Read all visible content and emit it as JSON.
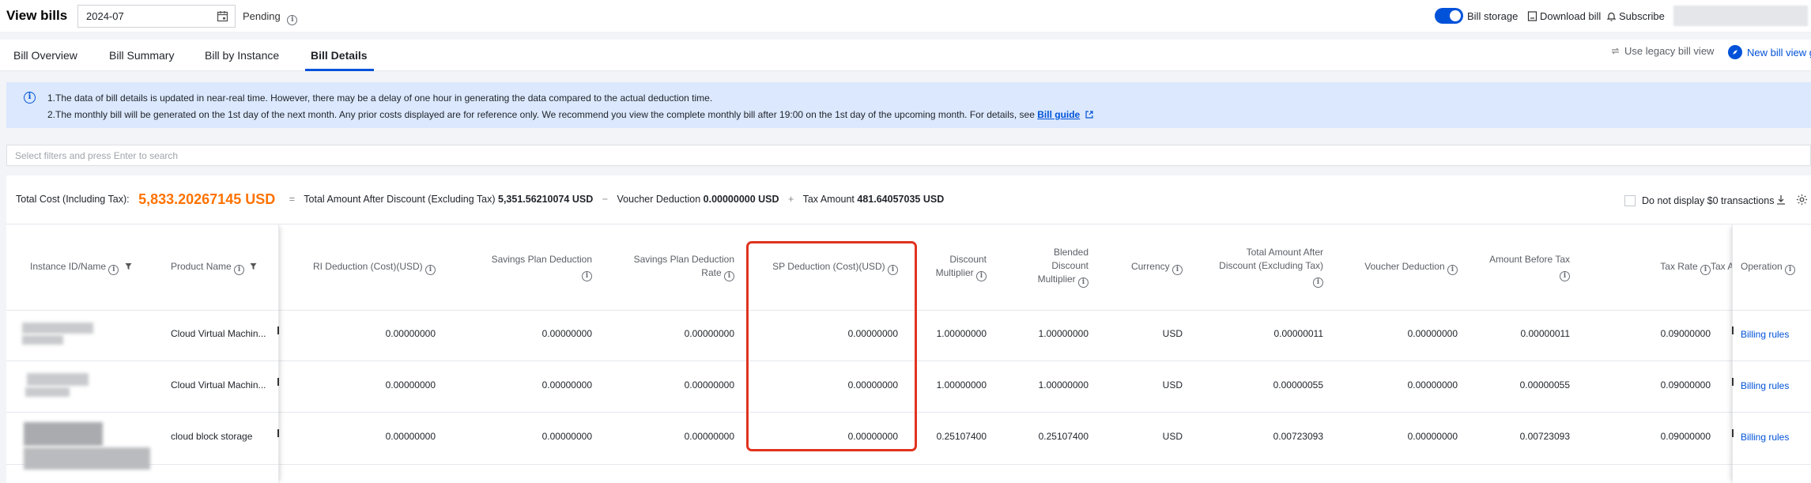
{
  "header": {
    "title": "View bills",
    "date_value": "2024-07",
    "status": "Pending",
    "bill_storage_label": "Bill storage",
    "download_label": "Download bill",
    "subscribe_label": "Subscribe"
  },
  "tabs": [
    {
      "label": "Bill Overview",
      "active": false
    },
    {
      "label": "Bill Summary",
      "active": false
    },
    {
      "label": "Bill by Instance",
      "active": false
    },
    {
      "label": "Bill Details",
      "active": true
    }
  ],
  "view_links": {
    "legacy": "Use legacy bill view",
    "new": "New bill view g"
  },
  "notice": {
    "line1": "1.The data of bill details is updated in near-real time. However, there may be a delay of one hour in generating the data compared to the actual deduction time.",
    "line2": "2.The monthly bill will be generated on the 1st day of the next month. Any prior costs displayed are for reference only. We recommend you view the complete monthly bill after 19:00 on the 1st day of the upcoming month. For details, see",
    "guide_link": "Bill guide"
  },
  "search": {
    "placeholder": "Select filters and press Enter to search"
  },
  "totals": {
    "label": "Total Cost (Including Tax):",
    "total_value": "5,833.20267145 USD",
    "eq": "=",
    "after_discount_label": "Total Amount After Discount (Excluding Tax)",
    "after_discount_value": "5,351.56210074 USD",
    "minus": "−",
    "voucher_label": "Voucher Deduction",
    "voucher_value": "0.00000000 USD",
    "plus": "+",
    "tax_label": "Tax Amount",
    "tax_value": "481.64057035 USD",
    "zero_option": "Do not display $0 transactions"
  },
  "table": {
    "headers": {
      "instance": "Instance ID/Name",
      "product": "Product Name",
      "ri": "RI Deduction (Cost)(USD)",
      "sp_ded_1": "Savings Plan Deduction",
      "sp_rate_1": "Savings Plan Deduction",
      "sp_rate_2": "Rate",
      "sp_cost": "SP Deduction (Cost)(USD)",
      "disc_1": "Discount",
      "disc_2": "Multiplier",
      "blend_1": "Blended",
      "blend_2": "Discount",
      "blend_3": "Multiplier",
      "currency": "Currency",
      "after_1": "Total Amount After",
      "after_2": "Discount (Excluding Tax)",
      "voucher": "Voucher Deduction",
      "before_tax": "Amount Before Tax",
      "tax_rate": "Tax Rate",
      "tax_a": "Tax A",
      "operation": "Operation"
    },
    "rows": [
      {
        "product": "Cloud Virtual Machin...",
        "ri": "0.00000000",
        "sp_ded": "0.00000000",
        "sp_rate": "0.00000000",
        "sp_cost": "0.00000000",
        "disc": "1.00000000",
        "blend": "1.00000000",
        "currency": "USD",
        "after": "0.00000011",
        "voucher": "0.00000000",
        "before_tax": "0.00000011",
        "tax_rate": "0.09000000",
        "op": "Billing rules"
      },
      {
        "product": "Cloud Virtual Machin...",
        "ri": "0.00000000",
        "sp_ded": "0.00000000",
        "sp_rate": "0.00000000",
        "sp_cost": "0.00000000",
        "disc": "1.00000000",
        "blend": "1.00000000",
        "currency": "USD",
        "after": "0.00000055",
        "voucher": "0.00000000",
        "before_tax": "0.00000055",
        "tax_rate": "0.09000000",
        "op": "Billing rules"
      },
      {
        "product": "cloud block storage",
        "ri": "0.00000000",
        "sp_ded": "0.00000000",
        "sp_rate": "0.00000000",
        "sp_cost": "0.00000000",
        "disc": "0.25107400",
        "blend": "0.25107400",
        "currency": "USD",
        "after": "0.00723093",
        "voucher": "0.00000000",
        "before_tax": "0.00723093",
        "tax_rate": "0.09000000",
        "op": "Billing rules"
      }
    ]
  },
  "colors": {
    "accent": "#0052d9",
    "total": "#ff7200",
    "highlight": "#e0331f",
    "notice_bg": "#dbe8fd"
  }
}
